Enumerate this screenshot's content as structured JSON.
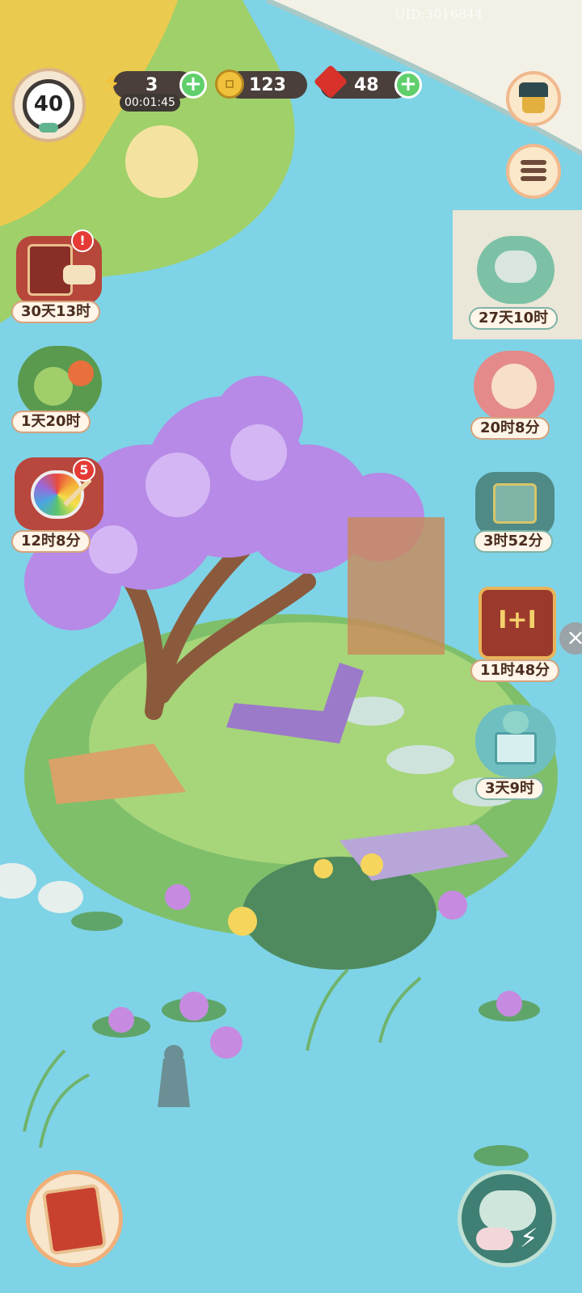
{
  "hud": {
    "level": "40",
    "energy": "3",
    "energy_timer": "00:01:45",
    "coins": "123",
    "gems": "48",
    "uid": "UID:3016844"
  },
  "left_events": [
    {
      "name": "event-book-scroll",
      "timer": "30天13时",
      "badge": "!"
    },
    {
      "name": "event-fruit-basket",
      "timer": "1天20时"
    },
    {
      "name": "event-paint-palette",
      "timer": "12时8分",
      "badge": "5"
    }
  ],
  "right_events": [
    {
      "name": "event-sleeping-cat",
      "timer": "27天10时"
    },
    {
      "name": "event-cat-portrait",
      "timer": "20时8分"
    },
    {
      "name": "event-treasure-box",
      "timer": "3时52分"
    },
    {
      "name": "event-bonus-1plus1",
      "timer": "11时48分"
    },
    {
      "name": "event-cat-gift",
      "timer": "3天9时"
    }
  ],
  "colors": {
    "water": "#7fd3e6",
    "hud_pill": "#4a3f3a",
    "plus_green": "#5fcf6c",
    "badge_red": "#e53a35",
    "blossom": "#b68ae6"
  }
}
